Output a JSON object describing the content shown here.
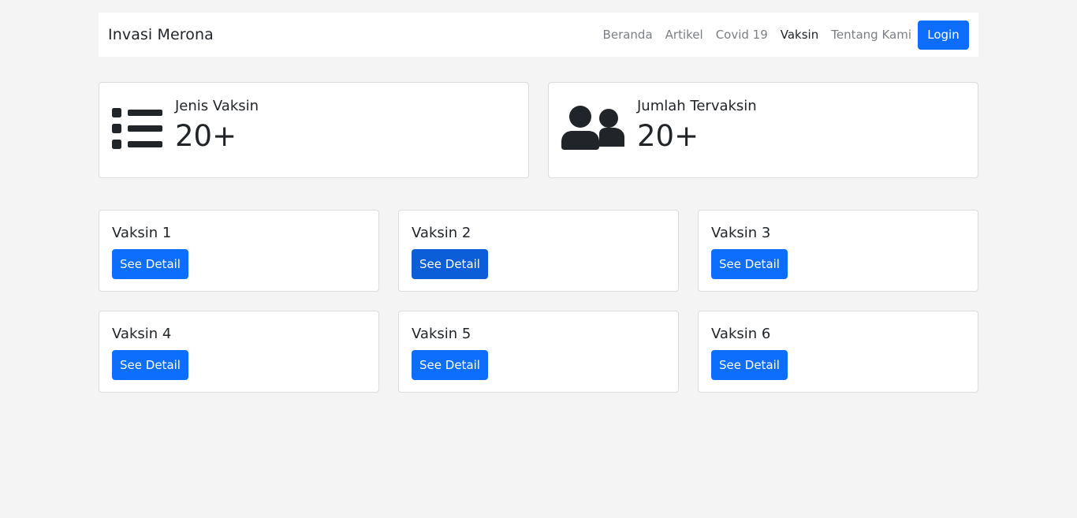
{
  "navbar": {
    "brand": "Invasi Merona",
    "links": [
      {
        "label": "Beranda",
        "active": false
      },
      {
        "label": "Artikel",
        "active": false
      },
      {
        "label": "Covid 19",
        "active": false
      },
      {
        "label": "Vaksin",
        "active": true
      },
      {
        "label": "Tentang Kami",
        "active": false
      }
    ],
    "login_label": "Login"
  },
  "stats": [
    {
      "title": "Jenis Vaksin",
      "value": "20+",
      "icon": "list-icon"
    },
    {
      "title": "Jumlah Tervaksin",
      "value": "20+",
      "icon": "users-icon"
    }
  ],
  "vaccines": [
    {
      "title": "Vaksin 1",
      "button": "See Detail"
    },
    {
      "title": "Vaksin 2",
      "button": "See Detail"
    },
    {
      "title": "Vaksin 3",
      "button": "See Detail"
    },
    {
      "title": "Vaksin 4",
      "button": "See Detail"
    },
    {
      "title": "Vaksin 5",
      "button": "See Detail"
    },
    {
      "title": "Vaksin 6",
      "button": "See Detail"
    }
  ],
  "colors": {
    "primary": "#0d6efd",
    "primary_hover": "#0b5ed7",
    "background": "#f4f4f4",
    "text": "#212529"
  }
}
